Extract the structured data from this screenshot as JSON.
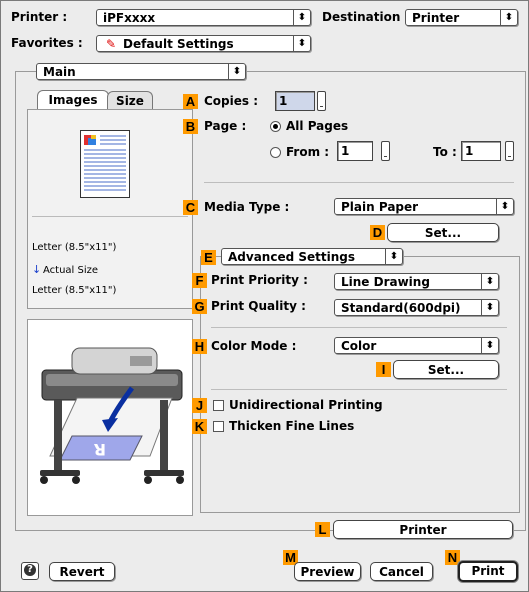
{
  "header": {
    "printer_label": "Printer :",
    "printer_value": "iPFxxxx",
    "destination_label": "Destination :",
    "destination_value": "Printer",
    "favorites_label": "Favorites :",
    "favorites_value": "Default Settings"
  },
  "panel_popup": "Main",
  "tabs": [
    "Images",
    "Size"
  ],
  "preview_info": {
    "paper_line1": "Letter (8.5\"x11\")",
    "size_line": "Actual Size",
    "paper_line2": "Letter (8.5\"x11\")"
  },
  "copies": {
    "badge": "A",
    "label": "Copies :",
    "value": "1"
  },
  "page": {
    "badge": "B",
    "label": "Page :",
    "all_pages": "All Pages",
    "from_label": "From :",
    "from_value": "1",
    "to_label": "To :",
    "to_value": "1"
  },
  "media": {
    "badge": "C",
    "label": "Media Type :",
    "value": "Plain Paper"
  },
  "media_set": {
    "badge": "D",
    "label": "Set..."
  },
  "advanced": {
    "badge": "E",
    "value": "Advanced Settings"
  },
  "priority": {
    "badge": "F",
    "label": "Print Priority :",
    "value": "Line Drawing"
  },
  "quality": {
    "badge": "G",
    "label": "Print Quality :",
    "value": "Standard(600dpi)"
  },
  "color_mode": {
    "badge": "H",
    "label": "Color Mode :",
    "value": "Color"
  },
  "color_set": {
    "badge": "I",
    "label": "Set..."
  },
  "unidirectional": {
    "badge": "J",
    "label": "Unidirectional Printing"
  },
  "thicken": {
    "badge": "K",
    "label": "Thicken Fine Lines"
  },
  "printer_btn": {
    "badge": "L",
    "label": "Printer"
  },
  "footer": {
    "help": "?",
    "revert": "Revert",
    "preview_badge": "M",
    "preview": "Preview",
    "cancel": "Cancel",
    "print_badge": "N",
    "print": "Print"
  },
  "colors": {
    "badge": "#ff9a00",
    "background": "#ececec"
  }
}
